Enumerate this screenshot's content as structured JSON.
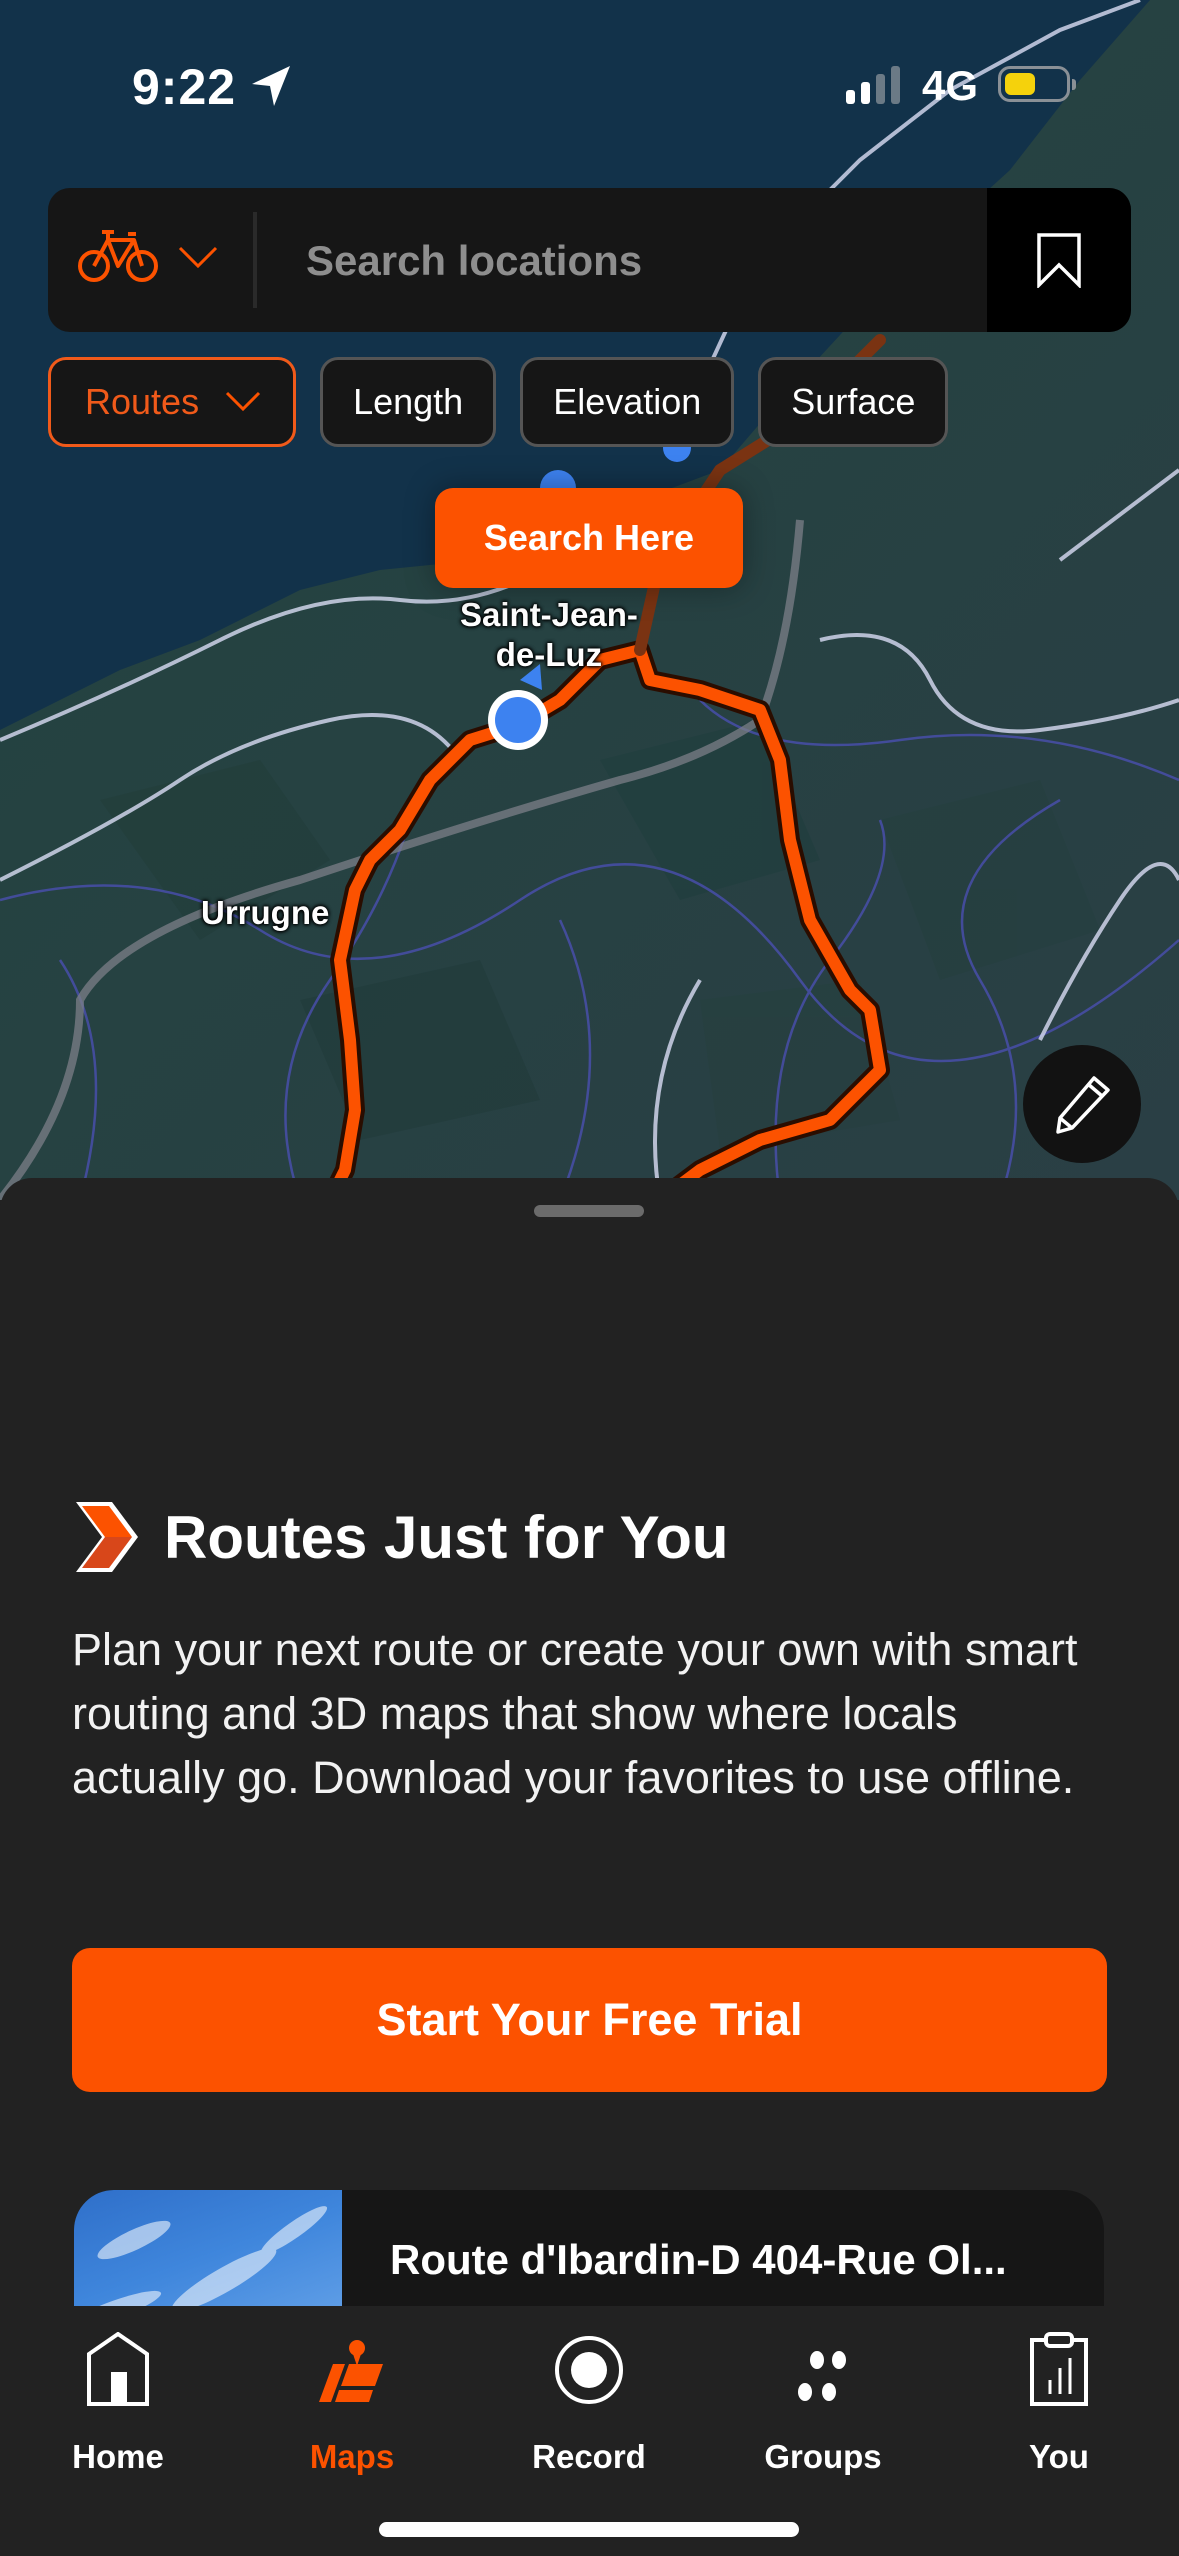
{
  "status_bar": {
    "time": "9:22",
    "network": "4G",
    "signal_bars_active": 2,
    "signal_bars_total": 4,
    "battery_level": 0.4,
    "battery_color": "#f5d20c"
  },
  "search": {
    "sport_icon": "bike-icon",
    "placeholder": "Search locations",
    "bookmark_icon": "bookmark-icon"
  },
  "filters": [
    {
      "label": "Routes",
      "active": true,
      "has_dropdown": true
    },
    {
      "label": "Length",
      "active": false
    },
    {
      "label": "Elevation",
      "active": false
    },
    {
      "label": "Surface",
      "active": false
    }
  ],
  "map": {
    "search_here_label": "Search Here",
    "places": [
      {
        "name": "Saint-Jean-\nde-Luz",
        "line1": "Saint-Jean-",
        "line2": "de-Luz"
      },
      {
        "name": "Urrugne"
      }
    ],
    "route_color": "#fc5200",
    "user_location_color": "#3d82f0",
    "edit_icon": "pencil-icon"
  },
  "sheet": {
    "promo_title": "Routes Just for You",
    "promo_body": "Plan your next route or create your own with smart routing and 3D maps that show where locals actually go. Download your favorites to use offline.",
    "cta_label": "Start Your Free Trial",
    "route_card_title": "Route d'Ibardin-D 404-Rue Ol..."
  },
  "tabbar": {
    "items": [
      {
        "label": "Home",
        "icon": "home-icon",
        "active": false
      },
      {
        "label": "Maps",
        "icon": "maps-icon",
        "active": true
      },
      {
        "label": "Record",
        "icon": "record-icon",
        "active": false
      },
      {
        "label": "Groups",
        "icon": "groups-icon",
        "active": false
      },
      {
        "label": "You",
        "icon": "clipboard-stats-icon",
        "active": false
      }
    ]
  },
  "colors": {
    "accent": "#fc5200",
    "sheet_bg": "#222222",
    "bar_bg": "#161616",
    "sea": "#12324a",
    "land": "#28474a"
  }
}
